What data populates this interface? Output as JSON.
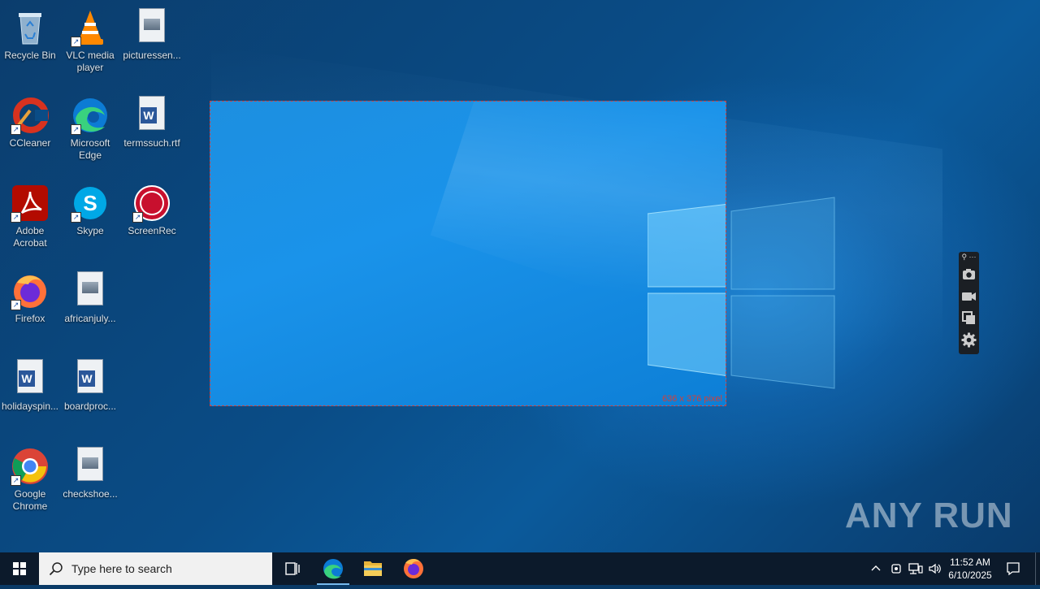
{
  "desktop_icons": [
    {
      "label": "Recycle Bin",
      "icon": "recycle-bin-icon"
    },
    {
      "label": "VLC media player",
      "icon": "vlc-icon"
    },
    {
      "label": "picturessen...",
      "icon": "image-file-icon"
    },
    {
      "label": "CCleaner",
      "icon": "ccleaner-icon"
    },
    {
      "label": "Microsoft Edge",
      "icon": "edge-icon"
    },
    {
      "label": "termssuch.rtf",
      "icon": "word-doc-icon"
    },
    {
      "label": "Adobe Acrobat",
      "icon": "acrobat-icon"
    },
    {
      "label": "Skype",
      "icon": "skype-icon"
    },
    {
      "label": "ScreenRec",
      "icon": "screenrec-icon"
    },
    {
      "label": "Firefox",
      "icon": "firefox-icon"
    },
    {
      "label": "africanjuly...",
      "icon": "image-file-icon"
    },
    {
      "label": "holidayspin...",
      "icon": "word-doc-icon"
    },
    {
      "label": "boardproc...",
      "icon": "word-doc-icon"
    },
    {
      "label": "Google Chrome",
      "icon": "chrome-icon"
    },
    {
      "label": "checkshoe...",
      "icon": "image-file-icon"
    }
  ],
  "selection": {
    "size_text": "636 x 376 pixel"
  },
  "capture_toolbar": {
    "items": [
      "pin-icon",
      "more-icon",
      "camera-icon",
      "video-icon",
      "copy-icon",
      "gear-icon"
    ]
  },
  "watermark": {
    "text": "ANY RUN"
  },
  "taskbar": {
    "search_placeholder": "Type here to search",
    "pinned": [
      "task-view-icon",
      "edge-icon",
      "file-explorer-icon",
      "firefox-icon"
    ],
    "tray_icons": [
      "chevron-up-icon",
      "meet-now-icon",
      "network-icon",
      "volume-icon"
    ],
    "time": "11:52 AM",
    "date": "6/10/2025"
  },
  "colors": {
    "selection_border": "#d0403a",
    "taskbar_bg": "#0c1a2b",
    "desktop_bg": "#0a4c86"
  }
}
